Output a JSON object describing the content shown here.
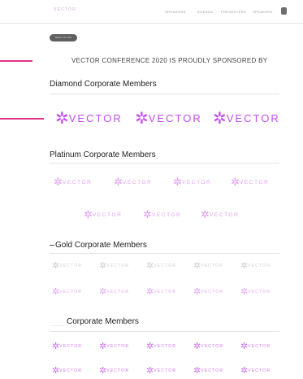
{
  "nav": {
    "logo_text": "VECTOR",
    "items": [
      "SPONSORS",
      "AGENDA",
      "PRESENTERS",
      "SPEAKERS"
    ]
  },
  "pill_label": "BACK TO TOP",
  "headline": "VECTOR CONFERENCE 2020 IS PROUDLY SPONSORED BY",
  "sections": {
    "diamond": "Diamond Corporate Members",
    "platinum": "Platinum Corporate Members",
    "gold": "Gold Corporate Members",
    "corporate": "Corporate Members"
  },
  "logo_text": "VECTOR",
  "logo_glyph": "✲",
  "colors": {
    "accent": "#c44cf0",
    "marker": "#e0338a"
  }
}
